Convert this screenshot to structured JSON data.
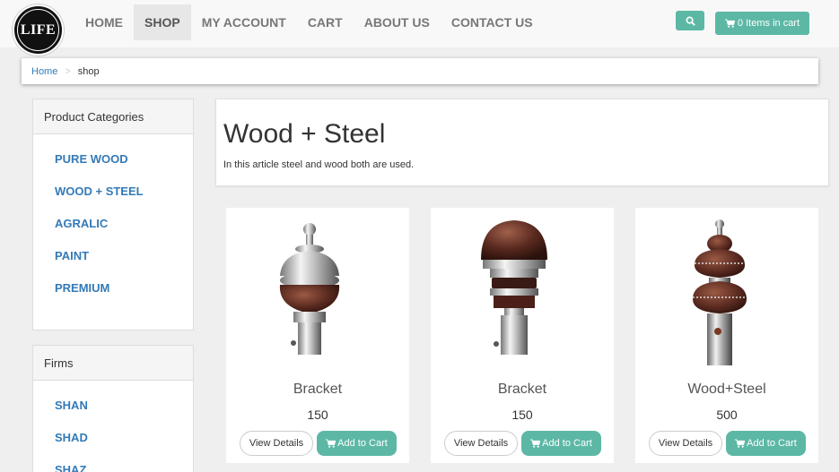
{
  "logo": {
    "text": "LIFE"
  },
  "nav": {
    "items": [
      {
        "label": "HOME"
      },
      {
        "label": "SHOP"
      },
      {
        "label": "MY ACCOUNT"
      },
      {
        "label": "CART"
      },
      {
        "label": "ABOUT US"
      },
      {
        "label": "CONTACT US"
      }
    ],
    "active": "SHOP"
  },
  "header": {
    "cart_label": "0 Items in cart"
  },
  "breadcrumb": {
    "home": "Home",
    "separator": ">",
    "current": "shop"
  },
  "sidebar": {
    "categories": {
      "title": "Product Categories",
      "items": [
        "PURE WOOD",
        "WOOD + STEEL",
        "AGRALIC",
        "PAINT",
        "PREMIUM"
      ]
    },
    "firms": {
      "title": "Firms",
      "items": [
        "SHAN",
        "SHAD",
        "SHAZ"
      ]
    }
  },
  "category": {
    "title": "Wood + Steel",
    "description": "In this article steel and wood both are used."
  },
  "products": [
    {
      "name": "Bracket",
      "price": "150",
      "details_label": "View Details",
      "add_label": "Add to Cart"
    },
    {
      "name": "Bracket",
      "price": "150",
      "details_label": "View Details",
      "add_label": "Add to Cart"
    },
    {
      "name": "Wood+Steel",
      "price": "500",
      "details_label": "View Details",
      "add_label": "Add to Cart"
    }
  ],
  "colors": {
    "accent": "#5cb8a5",
    "link": "#337ab7",
    "wood": "#5a2a20",
    "steel": "#c8c8c8"
  }
}
